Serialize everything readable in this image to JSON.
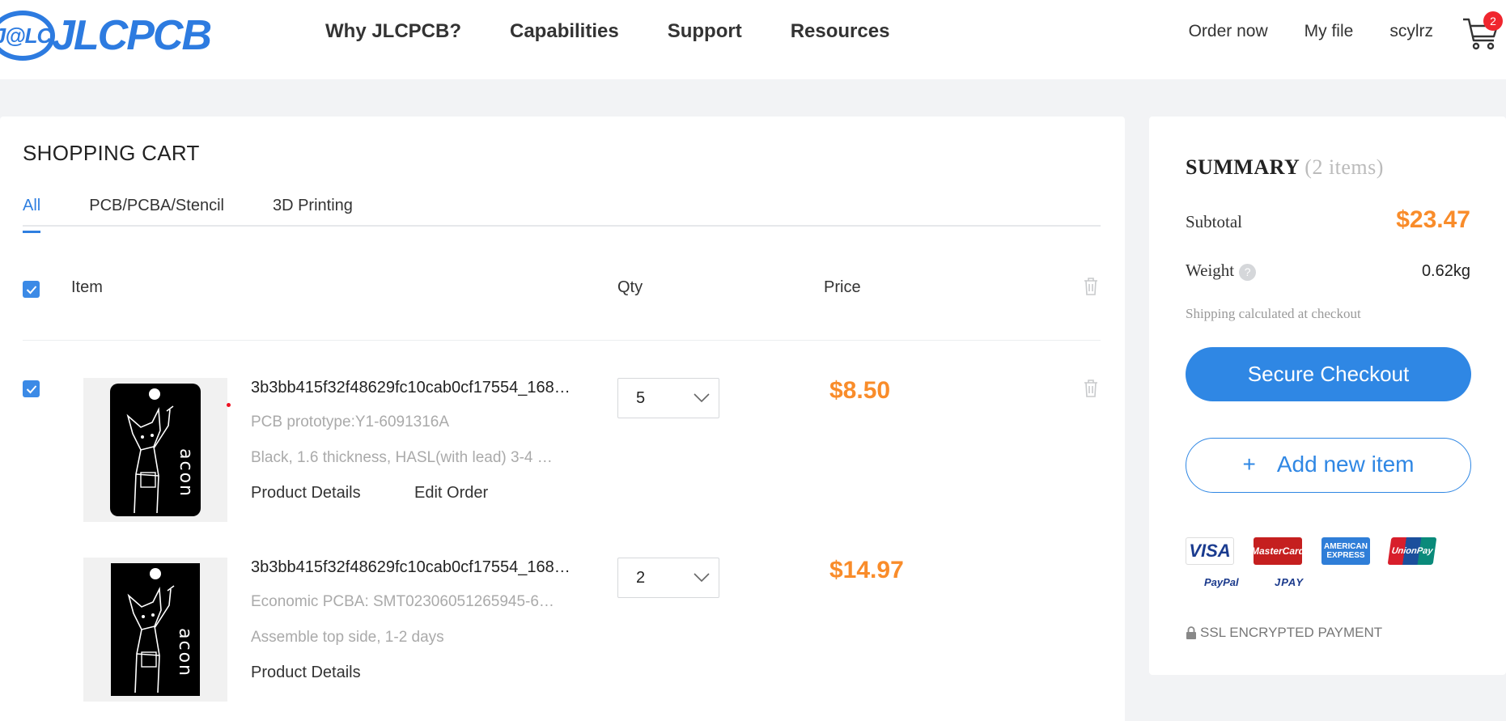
{
  "header": {
    "logo_badge": "J@LC",
    "logo_text": "JLCPCB",
    "nav": [
      "Why JLCPCB?",
      "Capabilities",
      "Support",
      "Resources"
    ],
    "links": [
      "Order now",
      "My file",
      "scylrz"
    ],
    "cart_count": "2"
  },
  "cart": {
    "title": "SHOPPING CART",
    "tabs": [
      "All",
      "PCB/PCBA/Stencil",
      "3D Printing"
    ],
    "active_tab": "All",
    "columns": {
      "item": "Item",
      "qty": "Qty",
      "price": "Price"
    },
    "select_all_checked": true,
    "items": [
      {
        "checked": true,
        "thumb_text": "acon",
        "name": "3b3bb415f32f48629fc10cab0cf17554_168…",
        "line1": "PCB prototype:Y1-6091316A",
        "line2": "Black, 1.6 thickness, HASL(with lead) 3-4 …",
        "links": [
          "Product Details",
          "Edit Order"
        ],
        "qty": "5",
        "price": "$8.50"
      },
      {
        "checked": false,
        "thumb_text": "acon",
        "name": "3b3bb415f32f48629fc10cab0cf17554_168…",
        "line1": "Economic PCBA: SMT02306051265945-6…",
        "line2": "Assemble top side, 1-2 days",
        "links": [
          "Product Details"
        ],
        "qty": "2",
        "price": "$14.97"
      }
    ]
  },
  "summary": {
    "title": "SUMMARY",
    "count": "(2 items)",
    "subtotal_label": "Subtotal",
    "subtotal_value": "$23.47",
    "weight_label": "Weight",
    "weight_help": "?",
    "weight_value": "0.62kg",
    "shipping_note": "Shipping calculated at checkout",
    "checkout_label": "Secure Checkout",
    "add_plus": "+",
    "add_label": "Add new item",
    "payments": {
      "visa": "VISA",
      "mastercard": "MasterCard",
      "amex_line1": "AMERICAN",
      "amex_line2": "EXPRESS",
      "unionpay": "UnionPay",
      "paypal": "PayPal",
      "jpay": "JPAY"
    },
    "ssl_label": "SSL ENCRYPTED PAYMENT"
  },
  "colors": {
    "brand_blue": "#2d7be0",
    "price_orange": "#f98c2a",
    "badge_red": "#f0262e"
  },
  "icons": [
    "cart-icon",
    "check-icon",
    "trash-icon",
    "chevron-down-icon",
    "help-icon",
    "lock-icon"
  ]
}
